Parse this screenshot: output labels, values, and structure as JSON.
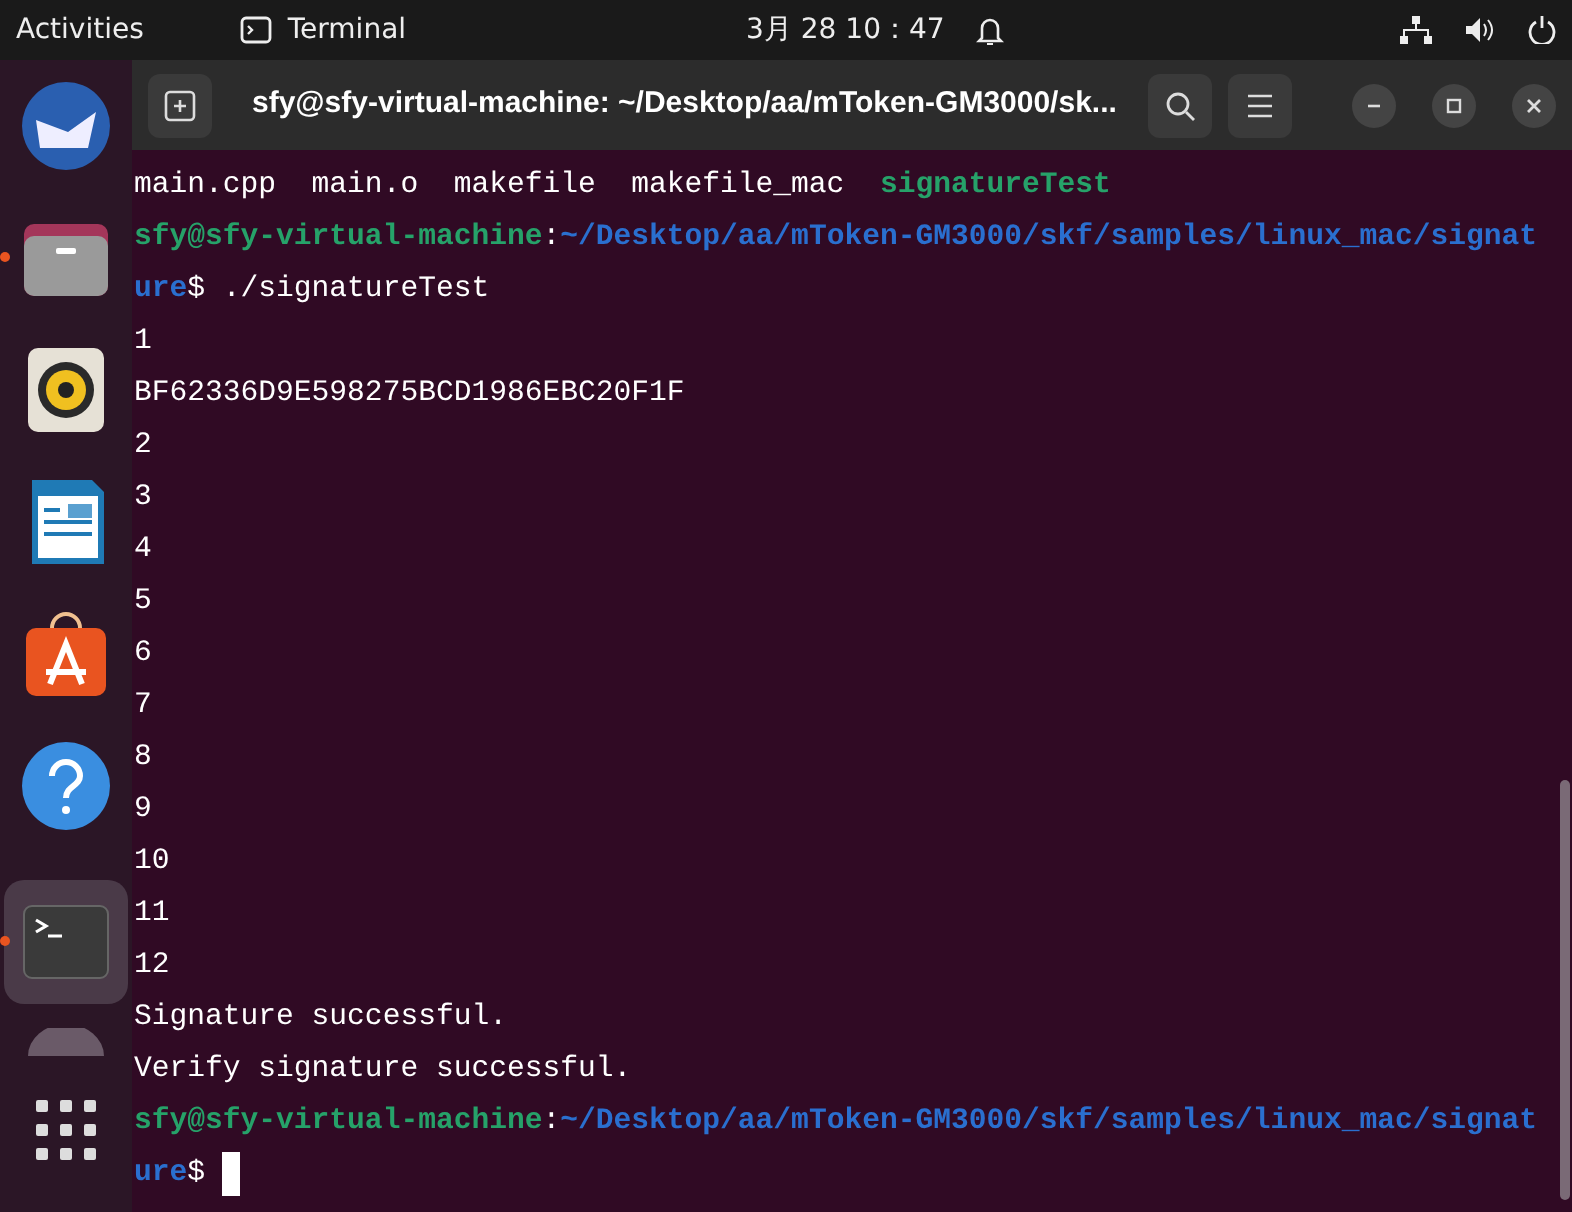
{
  "top_bar": {
    "activities": "Activities",
    "app_name": "Terminal",
    "clock": "3月 28 10：47"
  },
  "dock": {
    "items": [
      {
        "kind": "mail",
        "running": false
      },
      {
        "kind": "files",
        "running": true
      },
      {
        "kind": "music",
        "running": false
      },
      {
        "kind": "writer",
        "running": false
      },
      {
        "kind": "store",
        "running": false
      },
      {
        "kind": "help",
        "running": false
      },
      {
        "kind": "terminal",
        "running": true,
        "selected": true
      },
      {
        "kind": "partial",
        "running": false
      }
    ]
  },
  "window": {
    "title": "sfy@sfy-virtual-machine: ~/Desktop/aa/mToken-GM3000/sk..."
  },
  "terminal": {
    "lines": [
      {
        "segments": [
          {
            "kind": "plain",
            "text": "main.cpp  main.o  makefile  makefile_mac  "
          },
          {
            "kind": "exec",
            "text": "signatureTest"
          }
        ]
      },
      {
        "segments": [
          {
            "kind": "user",
            "text": "sfy@sfy-virtual-machine"
          },
          {
            "kind": "plain",
            "text": ":"
          },
          {
            "kind": "path",
            "text": "~/Desktop/aa/mToken-GM3000/skf/samples/linux_mac/signat"
          }
        ]
      },
      {
        "segments": [
          {
            "kind": "path",
            "text": "ure"
          },
          {
            "kind": "plain",
            "text": "$ ./signatureTest"
          }
        ]
      },
      {
        "segments": [
          {
            "kind": "plain",
            "text": "1"
          }
        ]
      },
      {
        "segments": [
          {
            "kind": "plain",
            "text": "BF62336D9E598275BCD1986EBC20F1F"
          }
        ]
      },
      {
        "segments": [
          {
            "kind": "plain",
            "text": "2"
          }
        ]
      },
      {
        "segments": [
          {
            "kind": "plain",
            "text": "3"
          }
        ]
      },
      {
        "segments": [
          {
            "kind": "plain",
            "text": "4"
          }
        ]
      },
      {
        "segments": [
          {
            "kind": "plain",
            "text": "5"
          }
        ]
      },
      {
        "segments": [
          {
            "kind": "plain",
            "text": "6"
          }
        ]
      },
      {
        "segments": [
          {
            "kind": "plain",
            "text": "7"
          }
        ]
      },
      {
        "segments": [
          {
            "kind": "plain",
            "text": "8"
          }
        ]
      },
      {
        "segments": [
          {
            "kind": "plain",
            "text": "9"
          }
        ]
      },
      {
        "segments": [
          {
            "kind": "plain",
            "text": "10"
          }
        ]
      },
      {
        "segments": [
          {
            "kind": "plain",
            "text": "11"
          }
        ]
      },
      {
        "segments": [
          {
            "kind": "plain",
            "text": "12"
          }
        ]
      },
      {
        "segments": [
          {
            "kind": "plain",
            "text": "Signature successful."
          }
        ]
      },
      {
        "segments": [
          {
            "kind": "plain",
            "text": "Verify signature successful."
          }
        ]
      },
      {
        "segments": [
          {
            "kind": "user",
            "text": "sfy@sfy-virtual-machine"
          },
          {
            "kind": "plain",
            "text": ":"
          },
          {
            "kind": "path",
            "text": "~/Desktop/aa/mToken-GM3000/skf/samples/linux_mac/signat"
          }
        ]
      },
      {
        "segments": [
          {
            "kind": "path",
            "text": "ure"
          },
          {
            "kind": "plain",
            "text": "$ "
          }
        ],
        "cursor": true
      }
    ]
  }
}
